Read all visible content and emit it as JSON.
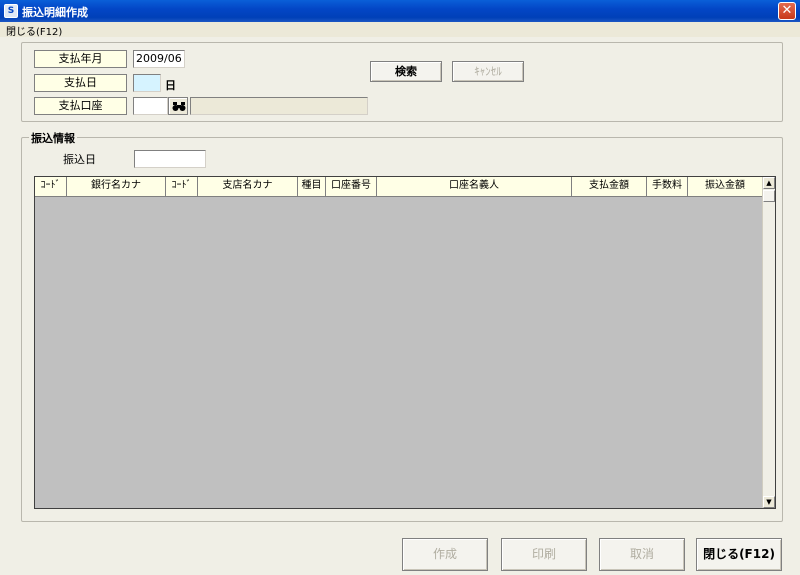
{
  "window": {
    "title": "振込明細作成",
    "close_glyph": "✕"
  },
  "menu": {
    "close_label": "閉じる(F12)"
  },
  "search_section": {
    "pay_month_label": "支払年月",
    "pay_month_value": "2009/06",
    "pay_day_label": "支払日",
    "pay_day_value": "",
    "pay_day_unit": "日",
    "pay_account_label": "支払口座",
    "pay_account_code": "",
    "pay_account_name": "",
    "search_button": "検索",
    "cancel_button": "ｷｬﾝｾﾙ"
  },
  "transfer_section": {
    "title": "振込情報",
    "transfer_date_label": "振込日",
    "transfer_date_value": ""
  },
  "grid": {
    "columns": [
      "ｺｰﾄﾞ",
      "銀行名カナ",
      "ｺｰﾄﾞ",
      "支店名カナ",
      "種目",
      "口座番号",
      "口座名義人",
      "支払金額",
      "手数料",
      "振込金額"
    ],
    "rows": []
  },
  "footer": {
    "create_button": "作成",
    "print_button": "印刷",
    "undo_button": "取消",
    "close_button": "閉じる(F12)"
  }
}
